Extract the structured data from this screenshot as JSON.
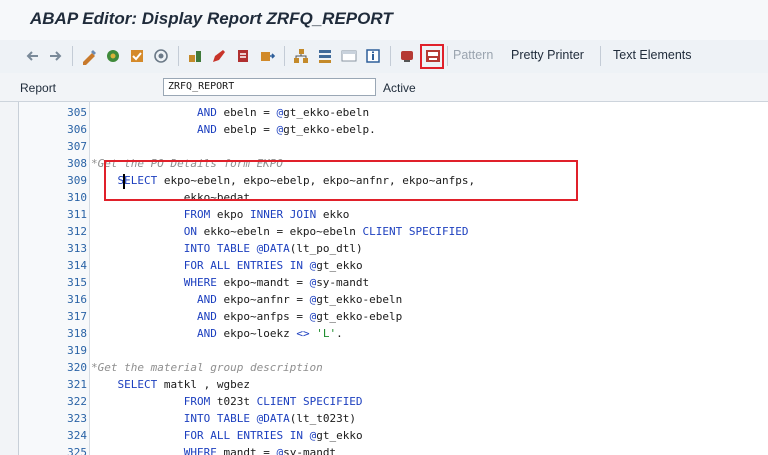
{
  "window": {
    "title": "ABAP Editor: Display Report ZRFQ_REPORT"
  },
  "toolbar": {
    "icons": [
      "back-arrow-icon",
      "forward-arrow-icon",
      "display-change-icon",
      "activate-icon",
      "check-icon",
      "where-used-icon",
      "object-list-icon",
      "edit-icon",
      "debug-icon",
      "copy-icon",
      "hierarchy-icon",
      "stack-icon",
      "window-icon",
      "info-icon",
      "pattern-insert-icon",
      "highlighted-breakpoint-icon"
    ],
    "pattern_label": "Pattern",
    "pretty_printer_label": "Pretty Printer",
    "text_elements_label": "Text Elements",
    "colors": {
      "highlight": "#e0202a"
    }
  },
  "report": {
    "label": "Report",
    "value": "ZRFQ_REPORT",
    "status": "Active"
  },
  "editor": {
    "lines": [
      {
        "n": "305",
        "code": "                AND ebeln = @gt_ekko-ebeln"
      },
      {
        "n": "306",
        "code": "                AND ebelp = @gt_ekko-ebelp."
      },
      {
        "n": "307",
        "code": ""
      },
      {
        "n": "308",
        "code": "*Get the PO Details form EKPO"
      },
      {
        "n": "309",
        "code": "    SELECT ekpo~ebeln, ekpo~ebelp, ekpo~anfnr, ekpo~anfps,"
      },
      {
        "n": "310",
        "code": "              ekko~bedat"
      },
      {
        "n": "311",
        "code": "              FROM ekpo INNER JOIN ekko"
      },
      {
        "n": "312",
        "code": "              ON ekko~ebeln = ekpo~ebeln CLIENT SPECIFIED"
      },
      {
        "n": "313",
        "code": "              INTO TABLE @DATA(lt_po_dtl)"
      },
      {
        "n": "314",
        "code": "              FOR ALL ENTRIES IN @gt_ekko"
      },
      {
        "n": "315",
        "code": "              WHERE ekpo~mandt = @sy-mandt"
      },
      {
        "n": "316",
        "code": "                AND ekpo~anfnr = @gt_ekko-ebeln"
      },
      {
        "n": "317",
        "code": "                AND ekpo~anfps = @gt_ekko-ebelp"
      },
      {
        "n": "318",
        "code": "                AND ekpo~loekz <> 'L'."
      },
      {
        "n": "319",
        "code": ""
      },
      {
        "n": "320",
        "code": "*Get the material group description"
      },
      {
        "n": "321",
        "code": "    SELECT matkl , wgbez"
      },
      {
        "n": "322",
        "code": "              FROM t023t CLIENT SPECIFIED"
      },
      {
        "n": "323",
        "code": "              INTO TABLE @DATA(lt_t023t)"
      },
      {
        "n": "324",
        "code": "              FOR ALL ENTRIES IN @gt_ekko"
      },
      {
        "n": "325",
        "code": "              WHERE mandt = @sy-mandt"
      }
    ]
  }
}
